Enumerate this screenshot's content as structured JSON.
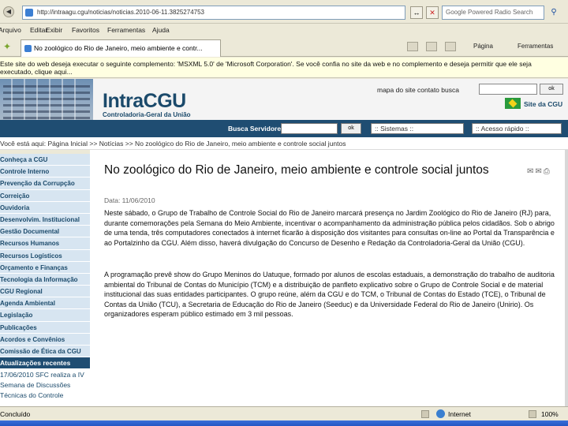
{
  "browser": {
    "url": "http://intraagu.cgu/noticias/noticias.2010-06-11.3825274753",
    "search_placeholder": "Google Powered Radio Search",
    "menu": [
      "Arquivo",
      "Editar",
      "Exibir",
      "Favoritos",
      "Ferramentas",
      "Ajuda"
    ],
    "tab_title": "No zoológico do Rio de Janeiro, meio ambiente e contr...",
    "toolbar_page": "Página",
    "toolbar_tools": "Ferramentas",
    "info_bar": "Este site do web deseja executar o seguinte complemento: 'MSXML 5.0' de 'Microsoft Corporation'. Se você confia no site da web e no complemento e deseja permitir que ele seja executado, clique aqui...",
    "status_text": "Concluído",
    "zone_label": "Internet",
    "zoom": "100%"
  },
  "site": {
    "logo": "IntraCGU",
    "logo_sub": "Controladoria-Geral da União",
    "top_links": "mapa do site   contato   busca",
    "search_ok": "ok",
    "site_link": "Site da CGU",
    "servidores_label": "Busca Servidores",
    "servidores_ok": "ok",
    "sistemas_select": ":: Sistemas ::",
    "acesso_select": ":: Acesso rápido ::"
  },
  "breadcrumb": "Você está aqui: Página Inicial >> Notícias >> No zoológico do Rio de Janeiro, meio ambiente e controle social juntos",
  "sidebar": {
    "items": [
      "Conheça a CGU",
      "Controle Interno",
      "Prevenção da Corrupção",
      "Correição",
      "Ouvidoria",
      "Desenvolvim. Institucional",
      "Gestão Documental",
      "Recursos Humanos",
      "Recursos Logísticos",
      "Orçamento e Finanças",
      "Tecnologia da Informação",
      "CGU Regional",
      "Agenda Ambiental",
      "Legislação",
      "Publicações",
      "Acordos e Convênios",
      "Comissão de Ética da CGU"
    ],
    "news_heading": "Atualizações recentes",
    "news_item": "17/06/2010 SFC realiza a IV Semana de Discussões Técnicas do Controle"
  },
  "article": {
    "title": "No zoológico do Rio de Janeiro, meio ambiente e controle social juntos",
    "date": "Data: 11/06/2010",
    "p1": "Neste sábado, o Grupo de Trabalho de Controle Social do Rio de Janeiro marcará presença no Jardim Zoológico do Rio de Janeiro (RJ) para, durante comemorações pela Semana do Meio Ambiente, incentivar o acompanhamento da administração pública pelos cidadãos. Sob o abrigo de uma tenda, três computadores conectados à internet ficarão à disposição dos visitantes para consultas on-line ao Portal da Transparência e ao Portalzinho da CGU. Além disso, haverá divulgação do Concurso de Desenho e Redação da Controladoria-Geral da União (CGU).",
    "p2": "A programação prevê show do Grupo Meninos do Uatuque, formado por alunos de escolas estaduais, a demonstração do trabalho de auditoria ambiental do Tribunal de Contas do Município (TCM) e a distribuição de panfleto explicativo sobre o Grupo de Controle Social e de material institucional das suas entidades participantes. O grupo reúne, além da CGU e do TCM, o Tribunal de Contas do Estado (TCE), o Tribunal de Contas da União (TCU), a Secretaria de Educação do Rio de Janeiro (Seeduc) e da Universidade Federal do Rio de Janeiro (Unirio). Os organizadores esperam público estimado em 3 mil pessoas."
  }
}
